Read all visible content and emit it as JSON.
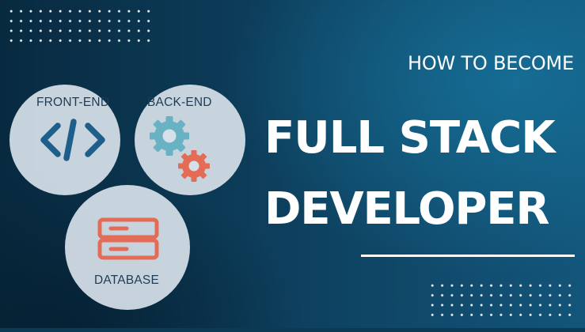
{
  "hero": {
    "subtitle": "HOW TO BECOME",
    "title_line1": "FULL STACK",
    "title_line2": "DEVELOPER"
  },
  "venn": {
    "front_end": "FRONT-END",
    "back_end": "BACK-END",
    "database": "DATABASE"
  },
  "icons": {
    "front_end": "code-brackets-icon",
    "back_end": "gears-icon",
    "database": "database-server-icon"
  },
  "colors": {
    "background": "#0e4261",
    "circle_fill": "#d6e0e8",
    "code_icon": "#1d5f8a",
    "gear_teal": "#69b2c4",
    "accent_orange": "#e46b55",
    "text_white": "#ffffff"
  }
}
